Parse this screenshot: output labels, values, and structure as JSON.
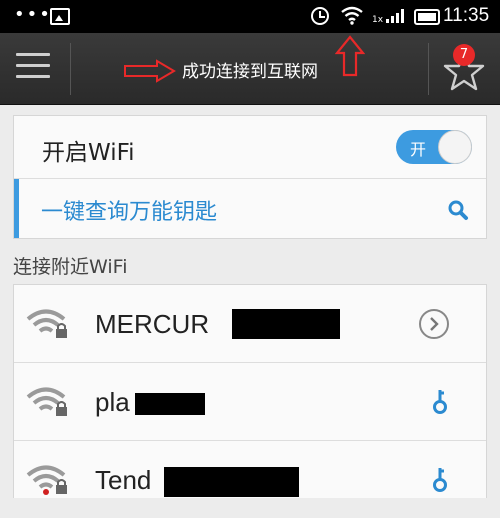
{
  "status_bar": {
    "time": "11:35",
    "signal_prefix": "1x",
    "icons": [
      "overflow-dots-icon",
      "image-notification-icon",
      "alarm-icon",
      "wifi-icon",
      "signal-icon",
      "battery-icon"
    ]
  },
  "action_bar": {
    "title": "成功连接到互联网",
    "badge_count": "7",
    "icons": [
      "menu-icon",
      "arrow-right-icon",
      "arrow-up-icon",
      "star-icon"
    ]
  },
  "wifi_toggle": {
    "label": "开启WiFi",
    "state_label": "开",
    "on": true,
    "accent": "#3d9be0"
  },
  "master_key": {
    "label": "一键查询万能钥匙"
  },
  "nearby": {
    "section_title": "连接附近WiFi",
    "networks": [
      {
        "name": "MERCUR",
        "locked": true,
        "action": "chevron-right-icon"
      },
      {
        "name": "pla",
        "locked": true,
        "action": "key-icon"
      },
      {
        "name": "Tend",
        "locked": true,
        "action": "key-icon"
      }
    ]
  },
  "colors": {
    "status_bar": "#000000",
    "action_bar": "#333333",
    "background": "#ececec",
    "annotation_red": "#e82929"
  }
}
